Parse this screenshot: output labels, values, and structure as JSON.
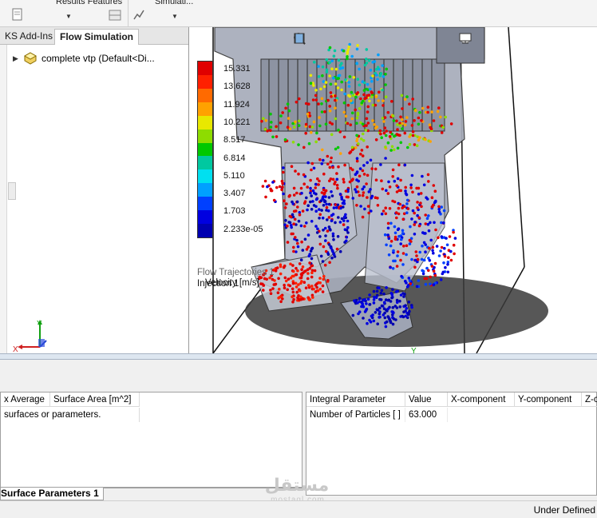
{
  "toolbar": {
    "results_features_label": "Results Features",
    "simulation_label": "Simulati..."
  },
  "tabs": [
    {
      "label": "KS Add-Ins",
      "active": false
    },
    {
      "label": "Flow Simulation",
      "active": true
    }
  ],
  "tree": {
    "item_label": "complete vtp  (Default<Di..."
  },
  "triad": {
    "x": "X",
    "y": "Y"
  },
  "legend": {
    "ticks": [
      "15.331",
      "13.628",
      "11.924",
      "10.221",
      "8.517",
      "6.814",
      "5.110",
      "3.407",
      "1.703",
      "2.233e-05"
    ],
    "unit": "Velocity [m/s]",
    "colors": [
      "#e00000",
      "#ff2000",
      "#ff6a00",
      "#ffa200",
      "#e8e800",
      "#8edc00",
      "#00c800",
      "#00c8a0",
      "#00e0f0",
      "#00a0ff",
      "#0040ff",
      "#0000e0",
      "#0000b0"
    ]
  },
  "plot": {
    "trajectories_label": "Flow Trajectories 1",
    "injection_label": "Injection 1",
    "axis_y": "Y"
  },
  "surface_grid": {
    "headers": [
      "x Average",
      "Surface Area [m^2]"
    ],
    "message": "surfaces or parameters."
  },
  "integral_grid": {
    "headers": [
      "Integral Parameter",
      "Value",
      "X-component",
      "Y-component",
      "Z-co"
    ],
    "rows": [
      {
        "parameter": "Number of Particles [ ]",
        "value": "63.000"
      }
    ]
  },
  "bottom_tab": {
    "label": "Surface Parameters 1"
  },
  "status": {
    "text": "Under Defined"
  },
  "watermark": {
    "text": "مستقل",
    "sub": "mostaql.com"
  }
}
